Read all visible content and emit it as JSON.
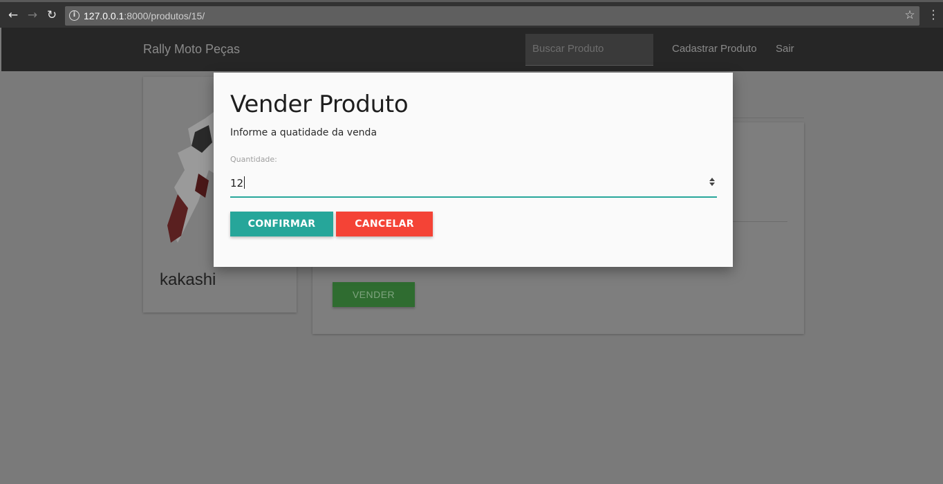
{
  "browser": {
    "url_host": "127.0.0.1",
    "url_rest": ":8000/produtos/15/",
    "back_icon": "back-arrow-icon",
    "forward_icon": "forward-arrow-icon",
    "reload_icon": "reload-icon"
  },
  "navbar": {
    "brand": "Rally Moto Peças",
    "search_placeholder": "Buscar Produto",
    "links": [
      "Cadastrar Produto",
      "Sair"
    ]
  },
  "product": {
    "name": "kakashi",
    "sell_label": "VENDER"
  },
  "modal": {
    "title": "Vender Produto",
    "description": "Informe a quatidade da venda",
    "quantity_label": "Quantidade:",
    "quantity_value": "12",
    "confirm_label": "CONFIRMAR",
    "cancel_label": "CANCELAR"
  },
  "colors": {
    "primary": "#26a69a",
    "danger": "#f44336",
    "success": "#388e3c"
  }
}
